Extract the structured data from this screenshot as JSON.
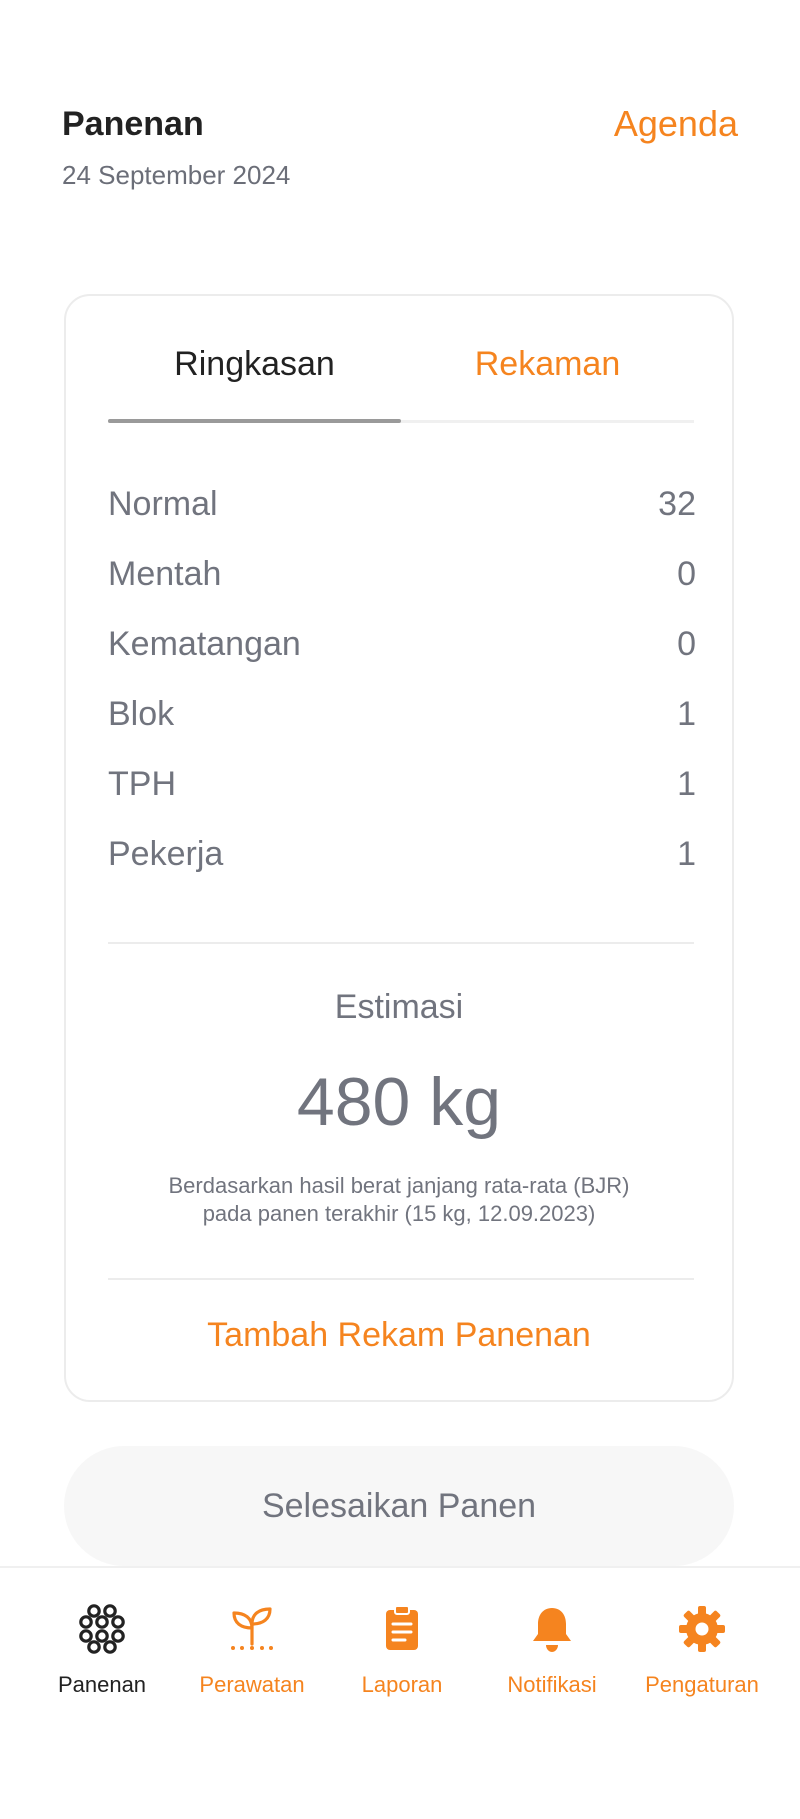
{
  "header": {
    "title": "Panenan",
    "date": "24 September 2024",
    "agenda_label": "Agenda"
  },
  "tabs": [
    {
      "label": "Ringkasan",
      "active": true
    },
    {
      "label": "Rekaman",
      "active": false
    }
  ],
  "summary": {
    "rows": [
      {
        "label": "Normal",
        "value": "32"
      },
      {
        "label": "Mentah",
        "value": "0"
      },
      {
        "label": "Kematangan",
        "value": "0"
      },
      {
        "label": "Blok",
        "value": "1"
      },
      {
        "label": "TPH",
        "value": "1"
      },
      {
        "label": "Pekerja",
        "value": "1"
      }
    ]
  },
  "estimate": {
    "label": "Estimasi",
    "value": "480 kg",
    "note_line1": "Berdasarkan hasil berat janjang rata-rata (BJR)",
    "note_line2": "pada panen terakhir (15 kg, 12.09.2023)"
  },
  "actions": {
    "add_record": "Tambah Rekam Panenan",
    "finish": "Selesaikan Panen"
  },
  "bottom_nav": [
    {
      "label": "Panenan",
      "icon": "harvest-icon",
      "active": true
    },
    {
      "label": "Perawatan",
      "icon": "sprout-icon",
      "active": false
    },
    {
      "label": "Laporan",
      "icon": "clipboard-icon",
      "active": false
    },
    {
      "label": "Notifikasi",
      "icon": "bell-icon",
      "active": false
    },
    {
      "label": "Pengaturan",
      "icon": "gear-icon",
      "active": false
    }
  ],
  "colors": {
    "accent": "#f5841f",
    "text_dark": "#222222",
    "text_muted": "#71747e"
  }
}
